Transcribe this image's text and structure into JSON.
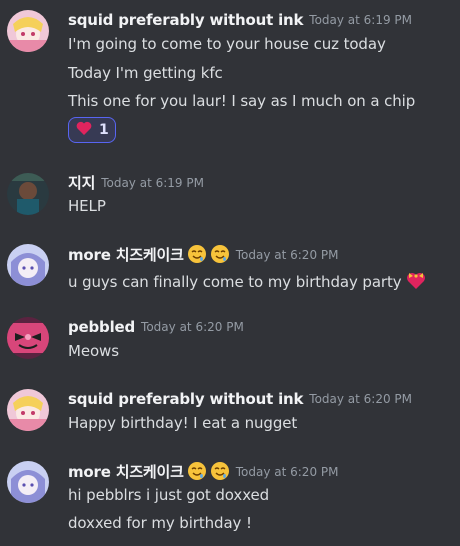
{
  "messages": [
    {
      "username": "squid preferably without ink",
      "timestamp": "Today at 6:19 PM",
      "lines": [
        "I'm going to come to your house cuz today",
        "Today I'm getting kfc",
        "This one for you laur! I say as I much on a chip"
      ],
      "reaction": {
        "emoji": "heart-emoji",
        "count": "1"
      }
    },
    {
      "username": "지지",
      "timestamp": "Today at 6:19 PM",
      "lines": [
        "HELP"
      ]
    },
    {
      "username": "more 치즈케이크",
      "timestamp": "Today at 6:20 PM",
      "lines": [
        "u guys can finally come to my birthday party"
      ]
    },
    {
      "username": "pebbled",
      "timestamp": "Today at 6:20 PM",
      "lines": [
        "Meows"
      ]
    },
    {
      "username": "squid preferably without ink",
      "timestamp": "Today at 6:20 PM",
      "lines": [
        "Happy birthday! I eat a nugget"
      ]
    },
    {
      "username": "more 치즈케이크",
      "timestamp": "Today at 6:20 PM",
      "lines": [
        "hi pebblrs i just got doxxed",
        "doxxed for my birthday !"
      ]
    }
  ],
  "colors": {
    "background": "#313338",
    "username": "#f2f3f5",
    "timestamp": "#949ba4",
    "text": "#dbdee1",
    "reaction_border": "#5865f2",
    "reaction_bg": "#373a54"
  }
}
